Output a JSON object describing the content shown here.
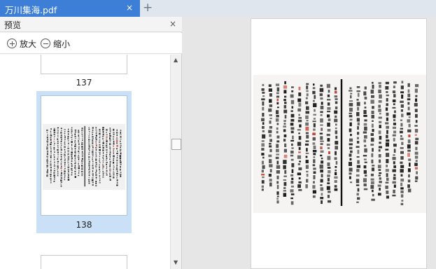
{
  "tab": {
    "title": "万川集海.pdf",
    "close_glyph": "×",
    "new_tab_glyph": "+"
  },
  "preview_panel": {
    "title": "预览",
    "close_glyph": "×",
    "zoom_in_label": "放大",
    "zoom_out_label": "缩小",
    "pages": [
      {
        "number": "137"
      },
      {
        "number": "138",
        "selected": true
      }
    ]
  },
  "scrollbar": {
    "up_glyph": "▲",
    "down_glyph": "▼"
  },
  "colors": {
    "tab_active": "#3d7fd6",
    "selected_thumb": "#c9e0f7",
    "ink": "#1a1a1a",
    "red_mark": "#c0392b"
  }
}
